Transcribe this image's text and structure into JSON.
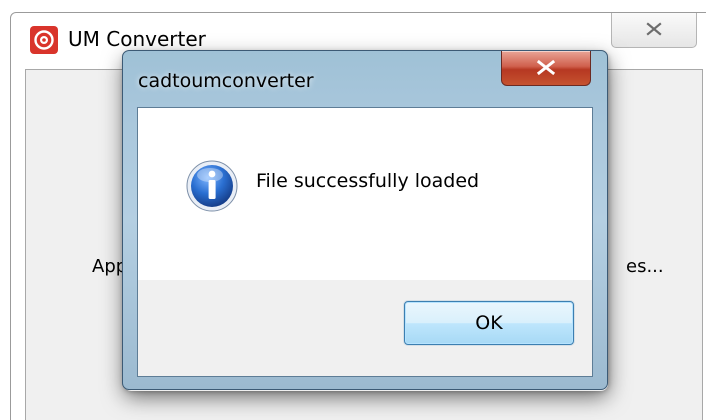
{
  "main_window": {
    "title": "UM Converter",
    "status_text_left": "Appl",
    "status_text_right": "es..."
  },
  "dialog": {
    "title": "cadtoumconverter",
    "message": "File successfully loaded",
    "ok_label": "OK",
    "icon": "info-icon"
  },
  "colors": {
    "logo_red": "#d9342b",
    "dialog_frame": "#a9c7dc",
    "close_red": "#c5432f",
    "info_blue": "#1f5fb8",
    "client_bg": "#f0f0f0"
  }
}
